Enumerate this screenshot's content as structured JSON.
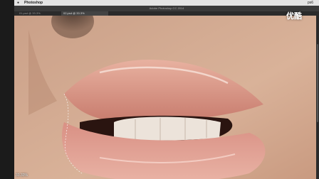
{
  "menubar": {
    "app_name": "Photoshop",
    "right_text": "ps6"
  },
  "window": {
    "title": "Adobe Photoshop CC 2014"
  },
  "tabs": [
    {
      "label": "01.psd @ 33.3%",
      "active": false
    },
    {
      "label": "02.psd @ 33.3%",
      "active": true
    }
  ],
  "status": {
    "zoom": "33.33%"
  },
  "watermark": {
    "text": "优酷"
  }
}
